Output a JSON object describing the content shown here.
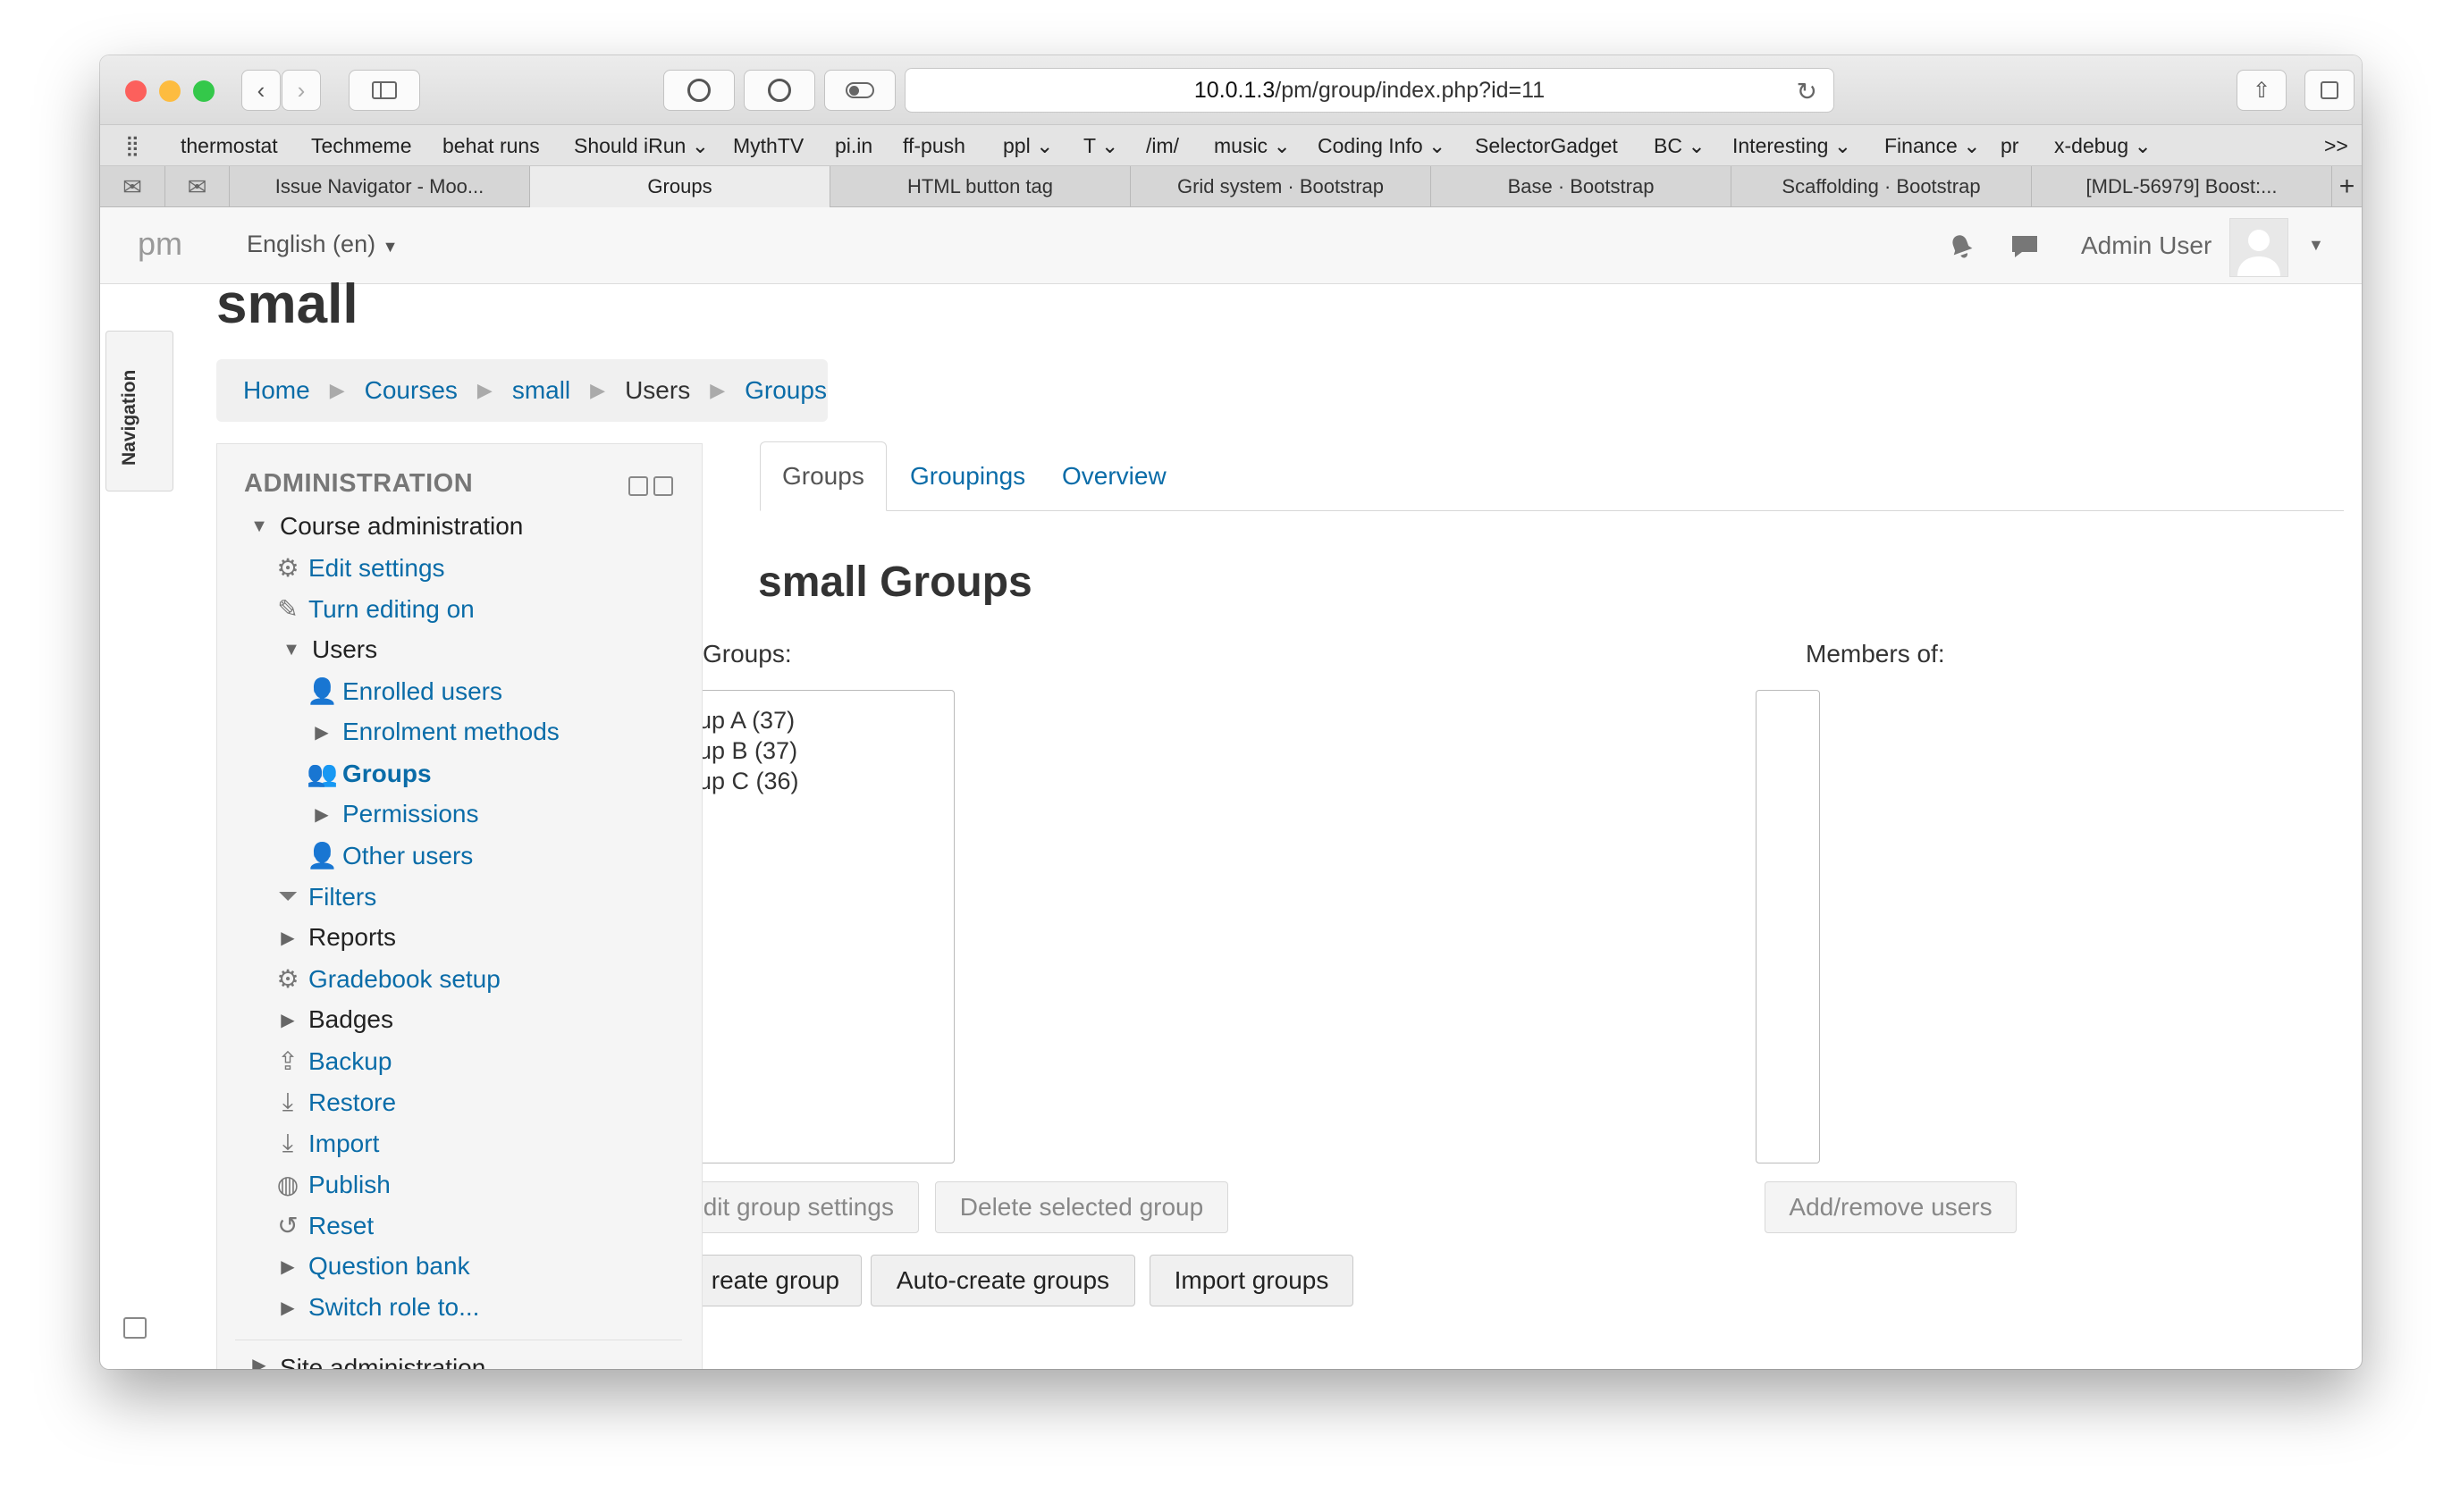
{
  "browser": {
    "url_host": "10.0.1.3",
    "url_path": "/pm/group/index.php?id=11",
    "bookmarks": [
      "thermostat",
      "Techmeme",
      "behat runs",
      "Should iRun",
      "MythTV",
      "pi.in",
      "ff-push",
      "ppl",
      "T",
      "/im/",
      "music",
      "Coding Info",
      "SelectorGadget",
      "BC",
      "Interesting",
      "Finance",
      "pr",
      "x-debug"
    ],
    "bookmarks_more": ">>",
    "tabs": [
      "Issue Navigator - Moo...",
      "Groups",
      "HTML button tag",
      "Grid system · Bootstrap",
      "Base · Bootstrap",
      "Scaffolding · Bootstrap",
      "[MDL-56979] Boost:..."
    ],
    "active_tab_index": 1,
    "new_tab": "+"
  },
  "navbar": {
    "brand": "pm",
    "language": "English (en)",
    "user_name": "Admin User"
  },
  "page": {
    "title": "small",
    "nav_drawer_label": "Navigation",
    "breadcrumb": [
      {
        "label": "Home",
        "link": true
      },
      {
        "label": "Courses",
        "link": true
      },
      {
        "label": "small",
        "link": true
      },
      {
        "label": "Users",
        "link": false
      },
      {
        "label": "Groups",
        "link": true
      }
    ]
  },
  "admin_block": {
    "title": "ADMINISTRATION",
    "items": [
      {
        "label": "Course administration",
        "link": false,
        "icon": "caret-down-icon"
      },
      {
        "label": "Edit settings",
        "link": true,
        "icon": "gear-icon"
      },
      {
        "label": "Turn editing on",
        "link": true,
        "icon": "pencil-icon"
      },
      {
        "label": "Users",
        "link": false,
        "icon": "caret-down-icon"
      },
      {
        "label": "Enrolled users",
        "link": true,
        "icon": "user-icon"
      },
      {
        "label": "Enrolment methods",
        "link": true,
        "icon": "caret-right-icon"
      },
      {
        "label": "Groups",
        "link": true,
        "icon": "users-icon",
        "bold": true
      },
      {
        "label": "Permissions",
        "link": true,
        "icon": "caret-right-icon"
      },
      {
        "label": "Other users",
        "link": true,
        "icon": "user-icon"
      },
      {
        "label": "Filters",
        "link": true,
        "icon": "filter-icon"
      },
      {
        "label": "Reports",
        "link": false,
        "icon": "caret-right-icon"
      },
      {
        "label": "Gradebook setup",
        "link": true,
        "icon": "gear-icon"
      },
      {
        "label": "Badges",
        "link": false,
        "icon": "caret-right-icon"
      },
      {
        "label": "Backup",
        "link": true,
        "icon": "upload-icon"
      },
      {
        "label": "Restore",
        "link": true,
        "icon": "download-icon"
      },
      {
        "label": "Import",
        "link": true,
        "icon": "import-icon"
      },
      {
        "label": "Publish",
        "link": true,
        "icon": "globe-icon"
      },
      {
        "label": "Reset",
        "link": true,
        "icon": "reset-icon"
      },
      {
        "label": "Question bank",
        "link": true,
        "icon": "caret-right-icon"
      },
      {
        "label": "Switch role to...",
        "link": true,
        "icon": "caret-right-icon"
      }
    ],
    "cut_off_item": "Site administration"
  },
  "tabs": [
    {
      "label": "Groups",
      "active": true
    },
    {
      "label": "Groupings",
      "active": false
    },
    {
      "label": "Overview",
      "active": false
    }
  ],
  "groups_page": {
    "heading": "small Groups",
    "groups_label": "Groups:",
    "members_label": "Members of:",
    "groups": [
      "up A (37)",
      "up B (37)",
      "up C (36)"
    ],
    "buttons": {
      "edit_group_settings": "Edit group settings",
      "delete_selected_group": "Delete selected group",
      "add_remove_users": "Add/remove users",
      "create_group": "reate group",
      "auto_create_groups": "Auto-create groups",
      "import_groups": "Import groups"
    }
  },
  "colors": {
    "link": "#0a6ca8",
    "close": "#fc605c",
    "minimize": "#fdbc40",
    "maximize": "#34c84a"
  }
}
